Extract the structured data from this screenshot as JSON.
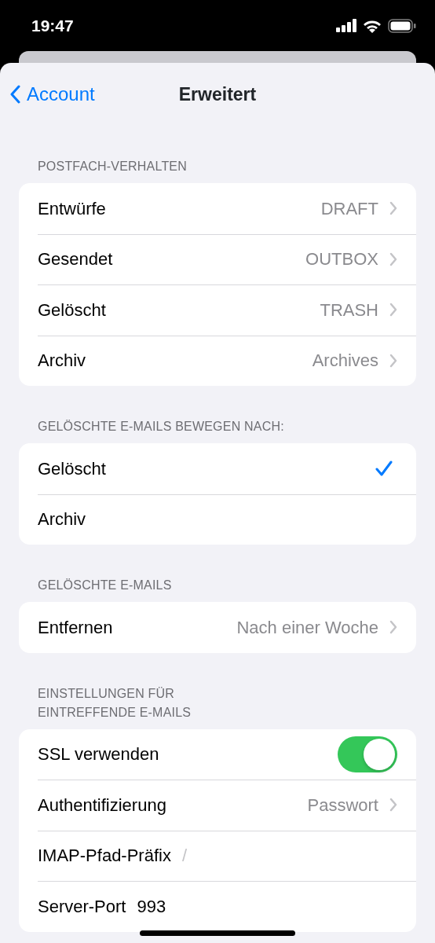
{
  "status_bar": {
    "time": "19:47"
  },
  "nav": {
    "back": "Account",
    "title": "Erweitert"
  },
  "sections": [
    {
      "header": "POSTFACH-VERHALTEN",
      "rows": [
        {
          "kind": "detail",
          "label": "Entwürfe",
          "value": "DRAFT"
        },
        {
          "kind": "detail",
          "label": "Gesendet",
          "value": "OUTBOX"
        },
        {
          "kind": "detail",
          "label": "Gelöscht",
          "value": "TRASH"
        },
        {
          "kind": "detail",
          "label": "Archiv",
          "value": "Archives"
        }
      ]
    },
    {
      "header": "GELÖSCHTE E-MAILS BEWEGEN NACH:",
      "rows": [
        {
          "kind": "check",
          "label": "Gelöscht",
          "selected": true
        },
        {
          "kind": "check",
          "label": "Archiv",
          "selected": false
        }
      ]
    },
    {
      "header": "GELÖSCHTE E-MAILS",
      "rows": [
        {
          "kind": "detail",
          "label": "Entfernen",
          "value": "Nach einer Woche"
        }
      ]
    },
    {
      "header": "EINSTELLUNGEN FÜR EINTREFFENDE E-MAILS",
      "rows": [
        {
          "kind": "toggle",
          "label": "SSL verwenden",
          "on": true
        },
        {
          "kind": "detail",
          "label": "Authentifizierung",
          "value": "Passwort"
        },
        {
          "kind": "field",
          "label": "IMAP-Pfad-Präfix",
          "placeholder": "/"
        },
        {
          "kind": "field",
          "label": "Server-Port",
          "value": "993"
        }
      ]
    }
  ]
}
